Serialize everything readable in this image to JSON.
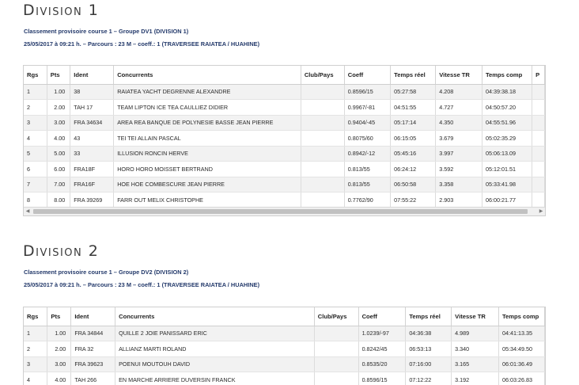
{
  "divisions": [
    {
      "title": "Division 1",
      "meta_line1": "Classement provisoire course 1 – Groupe DV1 (DIVISION 1)",
      "meta_line2": "25/05/2017 à 09:21 h. – Parcours : 23 M – coeff.: 1 (TRAVERSEE RAIATEA / HUAHINE)",
      "headers": [
        "Rgs",
        "Pts",
        "Ident",
        "Concurrents",
        "Club/Pays",
        "Coeff",
        "Temps réel",
        "Vitesse TR",
        "Temps comp",
        "P"
      ],
      "rows": [
        [
          "1",
          "1.00",
          "38",
          "RAIATEA YACHT DEGRENNE ALEXANDRE",
          "",
          "0.8596/15",
          "05:27:58",
          "4.208",
          "04:39:38.18",
          ""
        ],
        [
          "2",
          "2.00",
          "TAH 17",
          "TEAM LIPTON ICE TEA CAULLIEZ DIDIER",
          "",
          "0.9967/-81",
          "04:51:55",
          "4.727",
          "04:50:57.20",
          ""
        ],
        [
          "3",
          "3.00",
          "FRA 34634",
          "AREA REA BANQUE DE POLYNESIE BASSE JEAN PIERRE",
          "",
          "0.9404/-45",
          "05:17:14",
          "4.350",
          "04:55:51.96",
          ""
        ],
        [
          "4",
          "4.00",
          "43",
          "TEI TEI ALLAIN PASCAL",
          "",
          "0.8075/60",
          "06:15:05",
          "3.679",
          "05:02:35.29",
          ""
        ],
        [
          "5",
          "5.00",
          "33",
          "ILLUSION RONCIN HERVE",
          "",
          "0.8942/-12",
          "05:45:16",
          "3.997",
          "05:06:13.09",
          ""
        ],
        [
          "6",
          "6.00",
          "FRA18F",
          "HORO HORO MOISSET BERTRAND",
          "",
          "0.813/55",
          "06:24:12",
          "3.592",
          "05:12:01.51",
          ""
        ],
        [
          "7",
          "7.00",
          "FRA16F",
          "HOE HOE COMBESCURE JEAN PIERRE",
          "",
          "0.813/55",
          "06:50:58",
          "3.358",
          "05:33:41.98",
          ""
        ],
        [
          "8",
          "8.00",
          "FRA 39269",
          "FARR OUT MELIX CHRISTOPHE",
          "",
          "0.7762/90",
          "07:55:22",
          "2.903",
          "06:00:21.77",
          ""
        ]
      ]
    },
    {
      "title": "Division 2",
      "meta_line1": "Classement provisoire course 1 – Groupe DV2 (DIVISION 2)",
      "meta_line2": "25/05/2017 à 09:21 h. – Parcours : 23 M – coeff.: 1 (TRAVERSEE RAIATEA / HUAHINE)",
      "headers": [
        "Rgs",
        "Pts",
        "Ident",
        "Concurrents",
        "Club/Pays",
        "Coeff",
        "Temps réel",
        "Vitesse TR",
        "Temps comp"
      ],
      "rows": [
        [
          "1",
          "1.00",
          "FRA 34844",
          "QUILLE 2 JOIE PANISSARD ERIC",
          "",
          "1.0239/-97",
          "04:36:38",
          "4.989",
          "04:41:13.35"
        ],
        [
          "2",
          "2.00",
          "FRA 32",
          "ALLIANZ MARTI ROLAND",
          "",
          "0.8242/45",
          "06:53:13",
          "3.340",
          "05:34:49.50"
        ],
        [
          "3",
          "3.00",
          "FRA 39623",
          "POENUI MOUTOUH DAVID",
          "",
          "0.8535/20",
          "07:16:00",
          "3.165",
          "06:01:36.49"
        ],
        [
          "4",
          "4.00",
          "TAH 266",
          "EN MARCHE ARRIERE DUVERSIN FRANCK",
          "",
          "0.8596/15",
          "07:12:22",
          "3.192",
          "06:03:26.83"
        ]
      ]
    }
  ],
  "scrollbar": {
    "left_arrow": "◀",
    "right_arrow": "▶"
  }
}
